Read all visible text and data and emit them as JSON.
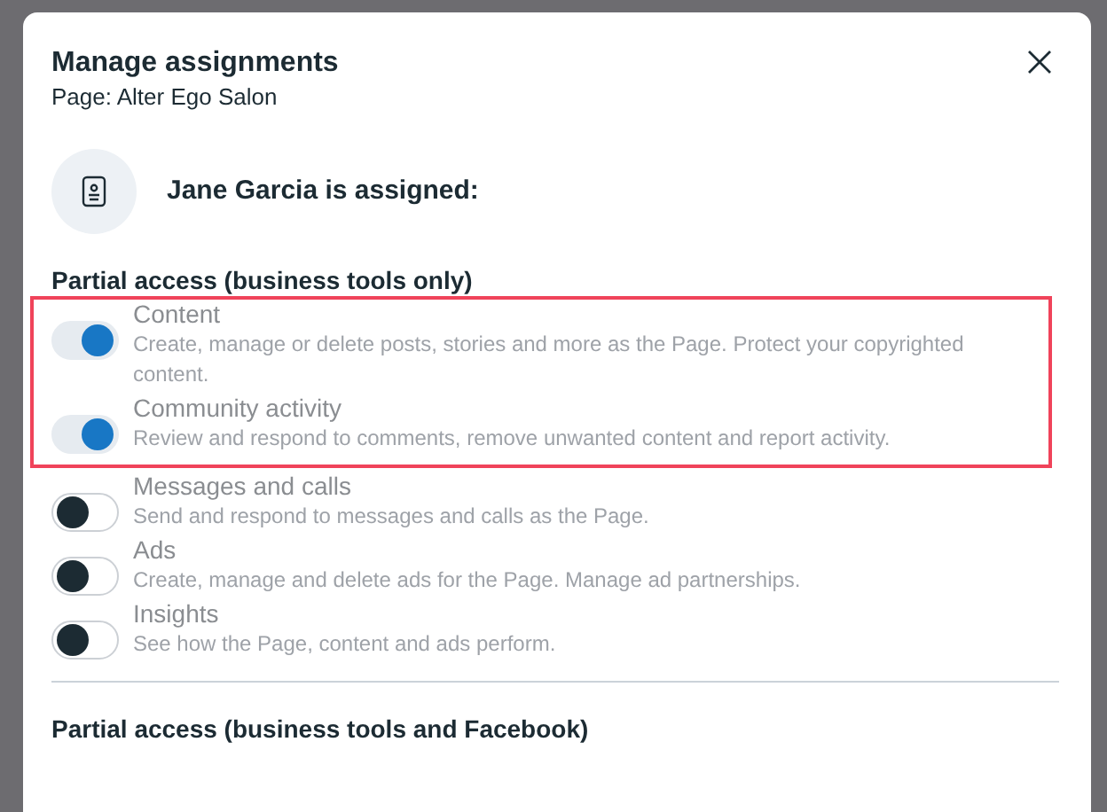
{
  "dialog": {
    "title": "Manage assignments",
    "subtitle": "Page: Alter Ego Salon",
    "assignee": "Jane Garcia is assigned:"
  },
  "sections": [
    {
      "heading": "Partial access (business tools only)",
      "permissions": [
        {
          "label": "Content",
          "description": "Create, manage or delete posts, stories and more as the Page. Protect your copyrighted content.",
          "on": true,
          "highlighted": true
        },
        {
          "label": "Community activity",
          "description": "Review and respond to comments, remove unwanted content and report activity.",
          "on": true,
          "highlighted": true
        },
        {
          "label": "Messages and calls",
          "description": "Send and respond to messages and calls as the Page.",
          "on": false,
          "highlighted": false
        },
        {
          "label": "Ads",
          "description": "Create, manage and delete ads for the Page. Manage ad partnerships.",
          "on": false,
          "highlighted": false
        },
        {
          "label": "Insights",
          "description": "See how the Page, content and ads perform.",
          "on": false,
          "highlighted": false
        }
      ]
    },
    {
      "heading": "Partial access (business tools and Facebook)"
    }
  ]
}
